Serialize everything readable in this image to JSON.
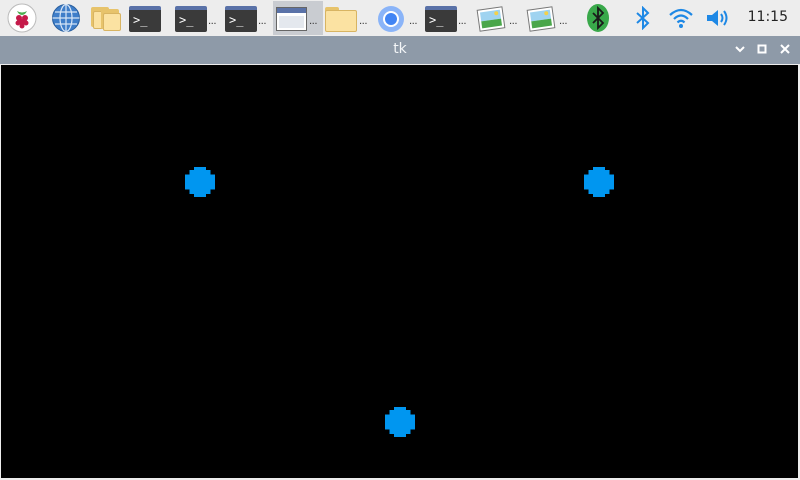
{
  "taskbar": {
    "ellipsis": "...",
    "clock": "11:15",
    "icons": [
      "raspberry-menu-icon",
      "globe-browser-icon",
      "file-manager-icon",
      "terminal-icon",
      "terminal-icon",
      "terminal-icon",
      "window-icon",
      "folder-icon",
      "chromium-icon",
      "terminal-icon",
      "image-viewer-icon",
      "image-viewer-icon",
      "bluetooth-icon",
      "bluetooth-icon",
      "wifi-icon",
      "volume-icon"
    ]
  },
  "window": {
    "title": "tk",
    "canvas_background": "#000000",
    "dot_color": "#0096f0",
    "dots": 3
  },
  "colors": {
    "taskbar_bg": "#ededed",
    "titlebar_bg": "#8e9aa8",
    "accent_blue": "#0096f0",
    "bluetooth_blue": "#1e88e5"
  }
}
